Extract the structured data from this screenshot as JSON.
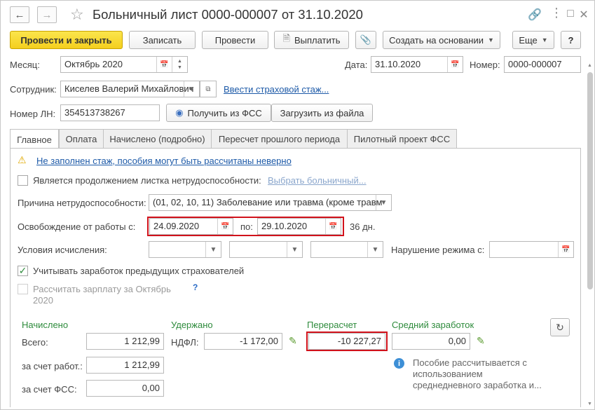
{
  "window": {
    "title": "Больничный лист 0000-000007 от 31.10.2020",
    "back_icon": "arrow-left-icon",
    "forward_icon": "arrow-right-icon"
  },
  "toolbar": {
    "post_close_label": "Провести и закрыть",
    "save_label": "Записать",
    "post_label": "Провести",
    "pay_label": "Выплатить",
    "create_based_label": "Создать на основании",
    "more_label": "Еще",
    "help_label": "?"
  },
  "header": {
    "month_label": "Месяц:",
    "month_value": "Октябрь 2020",
    "date_label": "Дата:",
    "date_value": "31.10.2020",
    "number_label": "Номер:",
    "number_value": "0000-000007",
    "employee_label": "Сотрудник:",
    "employee_value": "Киселев Валерий Михайлович",
    "insurance_link": "Ввести страховой стаж...",
    "ln_label": "Номер ЛН:",
    "ln_value": "354513738267",
    "get_fss_label": "Получить из ФСС",
    "load_file_label": "Загрузить из файла"
  },
  "tabs": [
    {
      "label": "Главное"
    },
    {
      "label": "Оплата"
    },
    {
      "label": "Начислено (подробно)"
    },
    {
      "label": "Пересчет прошлого периода"
    },
    {
      "label": "Пилотный проект ФСС"
    }
  ],
  "main": {
    "warning_link": "Не заполнен стаж, пособия могут быть рассчитаны неверно",
    "continuation_label": "Является продолжением листка нетрудоспособности:",
    "choose_sick_link": "Выбрать больничный...",
    "reason_label": "Причина нетрудоспособности:",
    "reason_value": "(01, 02, 10, 11) Заболевание или травма (кроме травм",
    "release_label": "Освобождение от работы с:",
    "release_from": "24.09.2020",
    "release_to_label": "по:",
    "release_to": "29.10.2020",
    "days": "36 дн.",
    "conditions_label": "Условия исчисления:",
    "violation_label": "Нарушение режима с:",
    "violation_value": " .  .",
    "prev_insurers_label": "Учитывать заработок предыдущих страхователей",
    "recalc_salary_label_1": "Рассчитать зарплату за Октябрь",
    "recalc_salary_label_2": "2020",
    "help_q": "?"
  },
  "totals": {
    "accrued_header": "Начислено",
    "withheld_header": "Удержано",
    "recalc_header": "Перерасчет",
    "avg_header": "Средний заработок",
    "total_label": "Всего:",
    "total_value": "1 212,99",
    "employer_label": "за счет работ.:",
    "employer_value": "1 212,99",
    "fss_label": "за счет ФСС:",
    "fss_value": "0,00",
    "ndfl_label": "НДФЛ:",
    "ndfl_value": "-1 172,00",
    "recalc_value": "-10 227,27",
    "avg_value": "0,00",
    "info_1": "Пособие рассчитывается с",
    "info_2": "использованием",
    "info_3": "среднедневного заработка и..."
  },
  "colors": {
    "primary_button": "#f4cf1e",
    "link": "#1d5aa8",
    "section_header": "#2e8b3c",
    "highlight": "#d1121b"
  }
}
